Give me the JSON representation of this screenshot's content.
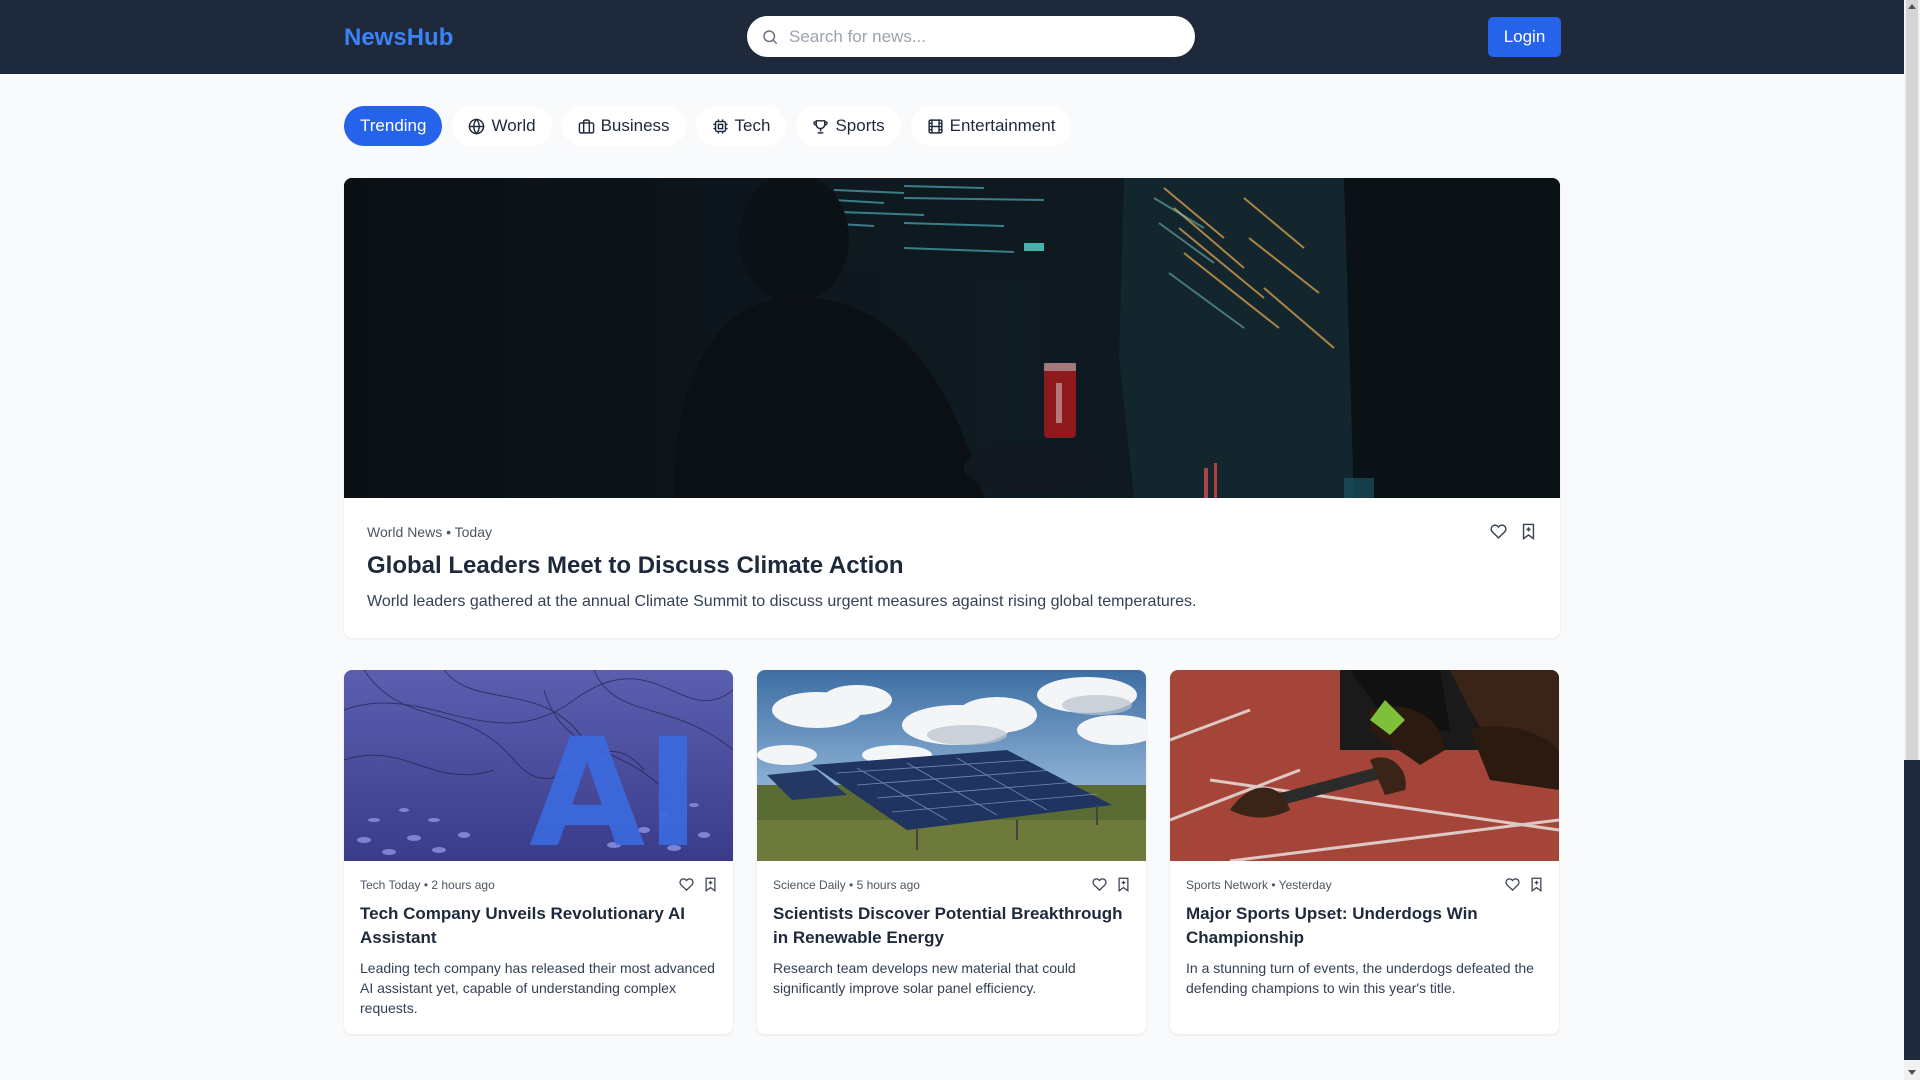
{
  "header": {
    "brand": "NewsHub",
    "search_placeholder": "Search for news...",
    "login_label": "Login"
  },
  "categories": [
    {
      "label": "Trending",
      "icon": "none",
      "active": true
    },
    {
      "label": "World",
      "icon": "globe-icon",
      "active": false
    },
    {
      "label": "Business",
      "icon": "briefcase-icon",
      "active": false
    },
    {
      "label": "Tech",
      "icon": "chip-icon",
      "active": false
    },
    {
      "label": "Sports",
      "icon": "trophy-icon",
      "active": false
    },
    {
      "label": "Entertainment",
      "icon": "film-icon",
      "active": false
    }
  ],
  "featured": {
    "meta": "World News • Today",
    "title": "Global Leaders Meet to Discuss Climate Action",
    "description": "World leaders gathered at the annual Climate Summit to discuss urgent measures against rising global temperatures."
  },
  "articles": [
    {
      "meta": "Tech Today • 2 hours ago",
      "title": "Tech Company Unveils Revolutionary AI Assistant",
      "description": "Leading tech company has released their most advanced AI assistant yet, capable of understanding complex requests.",
      "image_text": "AI"
    },
    {
      "meta": "Science Daily • 5 hours ago",
      "title": "Scientists Discover Potential Breakthrough in Renewable Energy",
      "description": "Research team develops new material that could significantly improve solar panel efficiency."
    },
    {
      "meta": "Sports Network • Yesterday",
      "title": "Major Sports Upset: Underdogs Win Championship",
      "description": "In a stunning turn of events, the underdogs defeated the defending champions to win this year's title."
    }
  ],
  "colors": {
    "header_bg": "#1e293b",
    "accent": "#2563eb",
    "brand": "#3b82f6",
    "page_bg": "#f8fafc"
  }
}
